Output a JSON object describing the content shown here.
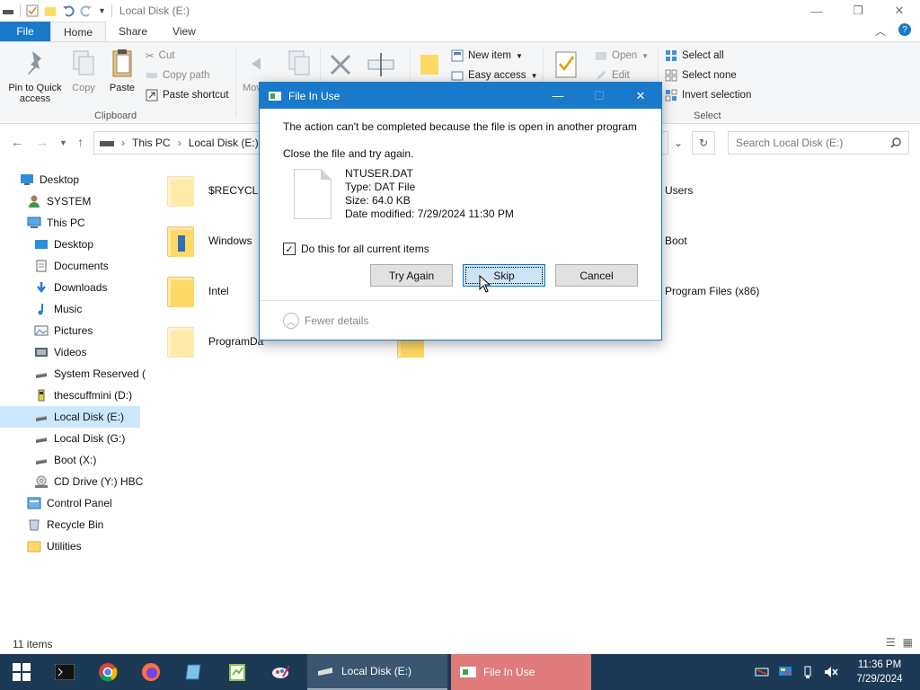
{
  "window": {
    "title": "Local Disk (E:)",
    "controls": {
      "minimize": "—",
      "maximize": "❐",
      "close": "✕"
    }
  },
  "ribbon": {
    "tabs": [
      "File",
      "Home",
      "Share",
      "View"
    ],
    "active_tab": "Home",
    "clipboard": {
      "pin": "Pin to Quick access",
      "copy": "Copy",
      "paste": "Paste",
      "cut": "Cut",
      "copy_path": "Copy path",
      "paste_shortcut": "Paste shortcut",
      "group_label": "Clipboard"
    },
    "organize": {
      "move_to": "Move to"
    },
    "new": {
      "new_item": "New item",
      "easy_access": "Easy access"
    },
    "open": {
      "open": "Open",
      "edit": "Edit"
    },
    "select": {
      "select_all": "Select all",
      "select_none": "Select none",
      "invert": "Invert selection",
      "group_label": "Select"
    }
  },
  "address": {
    "crumbs": [
      "This PC",
      "Local Disk (E:)"
    ],
    "search_placeholder": "Search Local Disk (E:)"
  },
  "sidebar": {
    "items": [
      {
        "label": "Desktop",
        "icon": "desktop-blue-icon"
      },
      {
        "label": "SYSTEM",
        "icon": "user-icon"
      },
      {
        "label": "This PC",
        "icon": "pc-icon"
      },
      {
        "label": "Desktop",
        "icon": "desktop-icon"
      },
      {
        "label": "Documents",
        "icon": "documents-icon"
      },
      {
        "label": "Downloads",
        "icon": "downloads-icon"
      },
      {
        "label": "Music",
        "icon": "music-icon"
      },
      {
        "label": "Pictures",
        "icon": "pictures-icon"
      },
      {
        "label": "Videos",
        "icon": "videos-icon"
      },
      {
        "label": "System Reserved (",
        "icon": "drive-icon"
      },
      {
        "label": "thescuffmini (D:)",
        "icon": "usb-drive-icon"
      },
      {
        "label": "Local Disk (E:)",
        "icon": "drive-icon",
        "selected": true
      },
      {
        "label": "Local Disk (G:)",
        "icon": "drive-icon"
      },
      {
        "label": "Boot (X:)",
        "icon": "drive-icon"
      },
      {
        "label": "CD Drive (Y:) HBC",
        "icon": "cd-drive-icon"
      },
      {
        "label": "Control Panel",
        "icon": "control-panel-icon"
      },
      {
        "label": "Recycle Bin",
        "icon": "recycle-bin-icon"
      },
      {
        "label": "Utilities",
        "icon": "folder-icon"
      }
    ]
  },
  "files": {
    "col1": [
      "$RECYCLE.",
      "Windows",
      "Intel",
      "ProgramDa"
    ],
    "col3": [
      "Users",
      "Boot",
      "Program Files (x86)"
    ]
  },
  "status": {
    "items": "11 items"
  },
  "dialog": {
    "title": "File In Use",
    "message": "The action can't be completed because the file is open in another program",
    "instruction": "Close the file and try again.",
    "file_name": "NTUSER.DAT",
    "file_type": "Type: DAT File",
    "file_size": "Size: 64.0 KB",
    "file_modified": "Date modified: 7/29/2024 11:30 PM",
    "checkbox_label": "Do this for all current items",
    "checkbox_checked": true,
    "buttons": {
      "try_again": "Try Again",
      "skip": "Skip",
      "cancel": "Cancel"
    },
    "fewer_details": "Fewer details"
  },
  "taskbar": {
    "tasks": [
      {
        "label": "Local Disk (E:)"
      },
      {
        "label": "File In Use"
      }
    ],
    "time": "11:36 PM",
    "date": "7/29/2024"
  }
}
